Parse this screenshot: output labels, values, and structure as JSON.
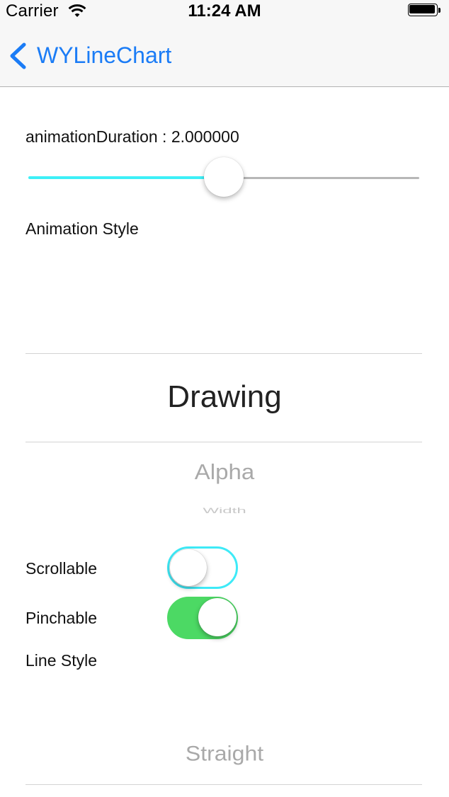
{
  "status_bar": {
    "carrier": "Carrier",
    "time": "11:24 AM",
    "wifi_icon": "wifi-icon",
    "battery_icon": "battery-icon"
  },
  "nav": {
    "back_label": "WYLineChart",
    "back_icon": "chevron-left-icon",
    "tint_color": "#1B7CF6"
  },
  "animation_duration": {
    "label": "animationDuration : 2.000000",
    "slider_value_fraction": 0.5,
    "min_track_color": "#3EF0F7",
    "max_track_color": "#B7B7B7"
  },
  "animation_style": {
    "label": "Animation Style",
    "selected": "Drawing",
    "options_below": [
      "Alpha",
      "Width"
    ]
  },
  "scrollable": {
    "label": "Scrollable",
    "on": false,
    "tint_color": "#3EEAF7"
  },
  "pinchable": {
    "label": "Pinchable",
    "on": true,
    "on_color": "#4CD964"
  },
  "line_style": {
    "label": "Line Style",
    "visible_option": "Straight"
  }
}
